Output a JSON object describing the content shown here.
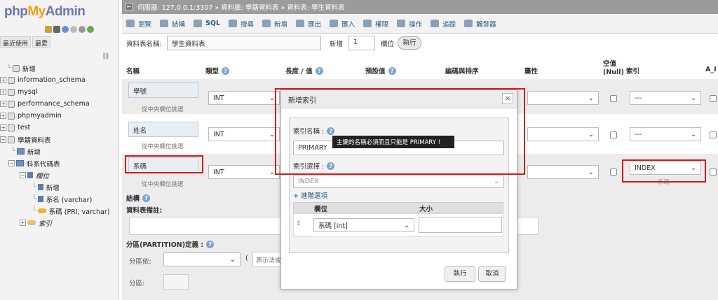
{
  "left": {
    "logo_php": "php",
    "logo_my": "My",
    "logo_admin": "Admin",
    "tabs": [
      "最近使用",
      "最愛"
    ],
    "tree": [
      {
        "label": "新增",
        "depth": 0,
        "kind": "new"
      },
      {
        "label": "information_schema",
        "depth": 0,
        "kind": "db"
      },
      {
        "label": "mysql",
        "depth": 0,
        "kind": "db"
      },
      {
        "label": "performance_schema",
        "depth": 0,
        "kind": "db"
      },
      {
        "label": "phpmyadmin",
        "depth": 0,
        "kind": "db"
      },
      {
        "label": "test",
        "depth": 0,
        "kind": "db"
      },
      {
        "label": "學籍資料表",
        "depth": 0,
        "kind": "db"
      },
      {
        "label": "新增",
        "depth": 1,
        "kind": "new"
      },
      {
        "label": "科系代碼表",
        "depth": 1,
        "kind": "table"
      },
      {
        "label": "欄位",
        "depth": 2,
        "kind": "folder"
      },
      {
        "label": "新增",
        "depth": 3,
        "kind": "new"
      },
      {
        "label": "系名 (varchar)",
        "depth": 3,
        "kind": "col"
      },
      {
        "label": "系碼 (PRI, varchar)",
        "depth": 3,
        "kind": "key"
      },
      {
        "label": "索引",
        "depth": 2,
        "kind": "folder"
      }
    ]
  },
  "breadcrumb": "伺服器: 127.0.0.1:3307 » 資料庫: 學籍資料表 » 資料表: 學生資料表",
  "tabs": [
    "瀏覽",
    "結構",
    "SQL",
    "搜尋",
    "新增",
    "匯出",
    "匯入",
    "權限",
    "操作",
    "追蹤",
    "觸發器"
  ],
  "form": {
    "table_name_label": "資料表名稱:",
    "table_name_value": "學生資料表",
    "add_label": "新增",
    "add_value": "1",
    "columns_label": "欄位",
    "run_label": "執行"
  },
  "headers": [
    "名稱",
    "類型",
    "長度 / 值",
    "預設值",
    "編碼與排序",
    "屬性",
    "空值\n(Null)",
    "索引",
    "A_I"
  ],
  "rows": [
    {
      "name": "學號",
      "type": "INT",
      "index": "---",
      "central": "從中央欄位挑選"
    },
    {
      "name": "姓名",
      "type": "INT",
      "index": "---",
      "central": "從中央欄位挑選"
    },
    {
      "name": "系碼",
      "type": "INT",
      "index": "INDEX",
      "central": "從中央欄位挑選",
      "index_sub": "系碼"
    }
  ],
  "lower": {
    "structure": "結構",
    "comment_label": "資料表備註:",
    "partition_label": "分區(PARTITION)定義 :",
    "partition_by": "分區依:",
    "expression_placeholder": "表示法或",
    "partitions": "分區:"
  },
  "dialog": {
    "title": "新增索引",
    "close": "×",
    "index_name_label": "索引名稱 :",
    "index_name_value": "PRIMARY",
    "tooltip": "主鍵的名稱必須而且只能是 PRIMARY !",
    "index_choice_label": "索引選擇 :",
    "index_choice_value": "INDEX",
    "advanced": "+ 進階選項",
    "col_header": "欄位",
    "size_header": "大小",
    "col_value": "系碼 [int]",
    "run": "執行",
    "cancel": "取消"
  },
  "colors": {
    "highlight": "#d7191c",
    "logo": "#6c78af",
    "logo_accent": "#f89c0e"
  }
}
